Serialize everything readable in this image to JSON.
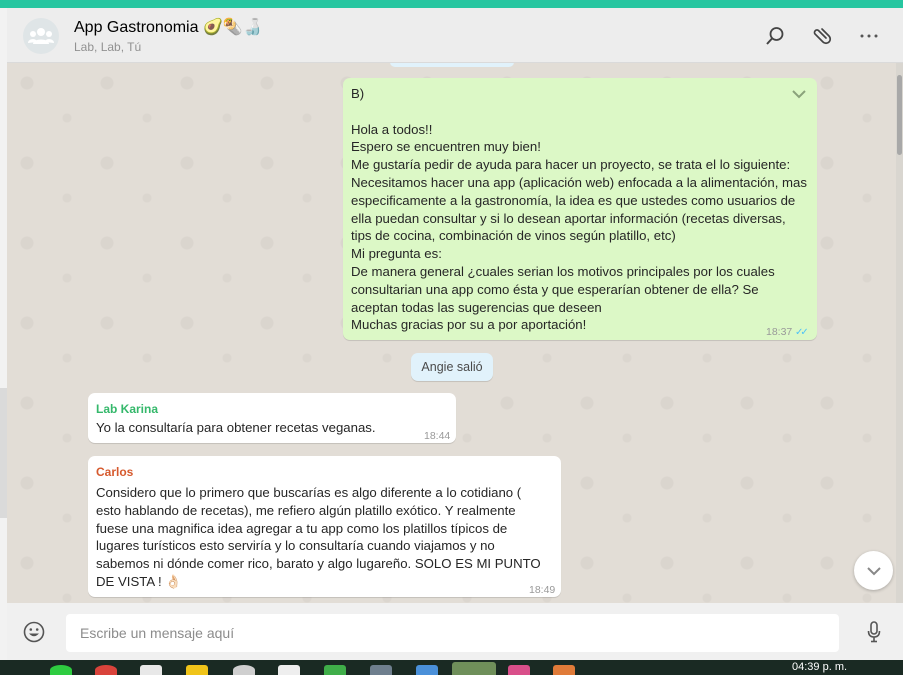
{
  "header": {
    "title": "App Gastronomia 🥑🌯🍶",
    "participants": "Lab, Lab, Tú",
    "icons": [
      "group-avatar-icon",
      "search-icon",
      "attach-icon",
      "menu-dots-icon"
    ]
  },
  "messages": {
    "outgoing": {
      "lines": [
        "B)",
        "",
        "Hola a todos!!",
        "Espero se encuentren muy bien!",
        "Me gustaría pedir de ayuda para hacer un proyecto, se trata el lo siguiente:",
        "Necesitamos hacer una app (aplicación web) enfocada a la alimentación, mas",
        "especificamente a la gastronomía,  la idea es que ustedes como usuarios de",
        "ella puedan consultar y si lo desean aportar información (recetas diversas,",
        "tips de cocina, combinación de vinos según platillo, etc)",
        "Mi pregunta es:",
        "De manera general  ¿cuales serian los motivos principales por los cuales",
        "consultarian una app como ésta y que esperarían obtener de ella? Se",
        "aceptan todas las sugerencias que deseen",
        "Muchas gracias por su a por aportación!"
      ],
      "time": "18:37",
      "ticks": "✓✓"
    },
    "system": "Angie salió",
    "karina": {
      "sender": "Lab Karina",
      "sender_color": "#35b86b",
      "text": "Yo la consultaría para obtener recetas veganas.",
      "time": "18:44"
    },
    "carlos": {
      "sender": "Carlos",
      "sender_color": "#d65a2e",
      "lines": [
        "Considero que lo primero que buscarías es algo diferente a lo cotidiano (",
        "esto hablando de recetas), me refiero algún platillo exótico. Y realmente",
        "fuese una magnifica idea agregar a tu app como los platillos típicos de",
        "lugares turísticos esto serviría y lo consultaría cuando viajamos y no",
        "sabemos ni dónde comer rico, barato y algo lugareño.  SOLO ES MI PUNTO",
        "DE VISTA ! 👌🏻"
      ],
      "time": "18:49"
    }
  },
  "composer": {
    "placeholder": "Escribe un mensaje aquí"
  },
  "taskbar": {
    "clock": "04:39 p. m."
  },
  "colors": {
    "accent": "#26c6a0",
    "outgoing_bubble": "#dcf8c6",
    "incoming_bubble": "#ffffff",
    "read_ticks": "#4fc3f7"
  }
}
